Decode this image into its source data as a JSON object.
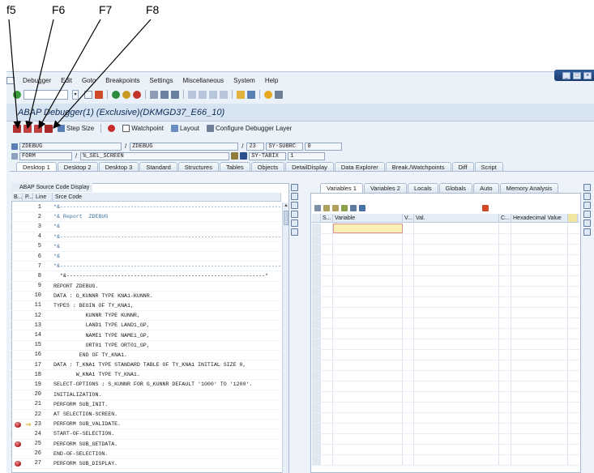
{
  "annotations": [
    "f5",
    "F6",
    "F7",
    "F8"
  ],
  "menu": {
    "items": [
      "Debugger",
      "Edit",
      "Goto",
      "Breakpoints",
      "Settings",
      "Miscellaneous",
      "System",
      "Help"
    ]
  },
  "title": "ABAP Debugger(1)  (Exclusive)(DKMGD37_E66_10)",
  "app_toolbar": {
    "step_size": "Step Size",
    "watchpoint": "Watchpoint",
    "layout": "Layout",
    "configure": "Configure Debugger Layer"
  },
  "vars": {
    "program1": "ZDEBUG",
    "program2": "ZDEBUG",
    "line": "23",
    "subrc_label": "SY-SUBRC",
    "subrc_value": "0",
    "type": "FORM",
    "event": "%_SEL_SCREEN",
    "tabix_label": "SY-TABIX",
    "tabix_value": "1"
  },
  "desktop_tabs": [
    "Desktop 1",
    "Desktop 2",
    "Desktop 3",
    "Standard",
    "Structures",
    "Tables",
    "Objects",
    "DetailDisplay",
    "Data Explorer",
    "Break./Watchpoints",
    "Diff",
    "Script"
  ],
  "source": {
    "panel_title": "ABAP Source Code Display",
    "col_b": "B...",
    "col_p": "P...",
    "col_line": "Line",
    "col_code": "Srce Code",
    "lines": [
      {
        "n": "1",
        "code": "*&---------------------------------------------------------------------",
        "cmt": true,
        "bp": false,
        "cur": false
      },
      {
        "n": "2",
        "code": "*& Report  ZDEBUG",
        "cmt": true,
        "bp": false,
        "cur": false
      },
      {
        "n": "3",
        "code": "*&",
        "cmt": true,
        "bp": false,
        "cur": false
      },
      {
        "n": "4",
        "code": "*&---------------------------------------------------------------------",
        "cmt": true,
        "bp": false,
        "cur": false
      },
      {
        "n": "5",
        "code": "*&",
        "cmt": true,
        "bp": false,
        "cur": false
      },
      {
        "n": "6",
        "code": "*&",
        "cmt": true,
        "bp": false,
        "cur": false
      },
      {
        "n": "7",
        "code": "*&---------------------------------------------------------------------",
        "cmt": true,
        "bp": false,
        "cur": false
      },
      {
        "n": "8",
        "code": "  *&--------------------------------------------------------------*",
        "cmt": false,
        "bp": false,
        "cur": false
      },
      {
        "n": "9",
        "code": "REPORT ZDEBUG.",
        "cmt": false,
        "bp": false,
        "cur": false
      },
      {
        "n": "10",
        "code": "DATA : G_KUNNR TYPE KNA1-KUNNR.",
        "cmt": false,
        "bp": false,
        "cur": false
      },
      {
        "n": "11",
        "code": "TYPES : BEGIN OF TY_KNA1,",
        "cmt": false,
        "bp": false,
        "cur": false
      },
      {
        "n": "12",
        "code": "          KUNNR TYPE KUNNR,",
        "cmt": false,
        "bp": false,
        "cur": false
      },
      {
        "n": "13",
        "code": "          LAND1 TYPE LAND1_GP,",
        "cmt": false,
        "bp": false,
        "cur": false
      },
      {
        "n": "14",
        "code": "          NAME1 TYPE NAME1_GP,",
        "cmt": false,
        "bp": false,
        "cur": false
      },
      {
        "n": "15",
        "code": "          ORT01 TYPE ORT01_GP,",
        "cmt": false,
        "bp": false,
        "cur": false
      },
      {
        "n": "16",
        "code": "        END OF TY_KNA1.",
        "cmt": false,
        "bp": false,
        "cur": false
      },
      {
        "n": "17",
        "code": "DATA : T_KNA1 TYPE STANDARD TABLE OF TY_KNA1 INITIAL SIZE 0,",
        "cmt": false,
        "bp": false,
        "cur": false
      },
      {
        "n": "18",
        "code": "       W_KNA1 TYPE TY_KNA1.",
        "cmt": false,
        "bp": false,
        "cur": false
      },
      {
        "n": "19",
        "code": "SELECT-OPTIONS : S_KUNNR FOR G_KUNNR DEFAULT '1000' TO '1200'.",
        "cmt": false,
        "bp": false,
        "cur": false
      },
      {
        "n": "20",
        "code": "INITIALIZATION.",
        "cmt": false,
        "bp": false,
        "cur": false
      },
      {
        "n": "21",
        "code": "PERFORM SUB_INIT.",
        "cmt": false,
        "bp": false,
        "cur": false
      },
      {
        "n": "22",
        "code": "AT SELECTION-SCREEN.",
        "cmt": false,
        "bp": false,
        "cur": false
      },
      {
        "n": "23",
        "code": "PERFORM SUB_VALIDATE.",
        "cmt": false,
        "bp": true,
        "cur": true
      },
      {
        "n": "24",
        "code": "START-OF-SELECTION.",
        "cmt": false,
        "bp": false,
        "cur": false
      },
      {
        "n": "25",
        "code": "PERFORM SUB_GETDATA.",
        "cmt": false,
        "bp": true,
        "cur": false
      },
      {
        "n": "26",
        "code": "END-OF-SELECTION.",
        "cmt": false,
        "bp": false,
        "cur": false
      },
      {
        "n": "27",
        "code": "PERFORM SUB_DISPLAY.",
        "cmt": false,
        "bp": true,
        "cur": false
      }
    ]
  },
  "variables": {
    "tabs": [
      "Variables 1",
      "Variables 2",
      "Locals",
      "Globals",
      "Auto",
      "Memory Analysis"
    ],
    "col_s": "S...",
    "col_variable": "Variable",
    "col_v": "V...",
    "col_val": "Val.",
    "col_c": "C...",
    "col_hex": "Hexadecimal Value"
  },
  "colors": {
    "frame_bg": "#eaf1f8",
    "title_color": "#0b2a55",
    "comment_color": "#3c6e9c",
    "breakpoint": "#b22222",
    "current_arrow": "#d4a000"
  }
}
